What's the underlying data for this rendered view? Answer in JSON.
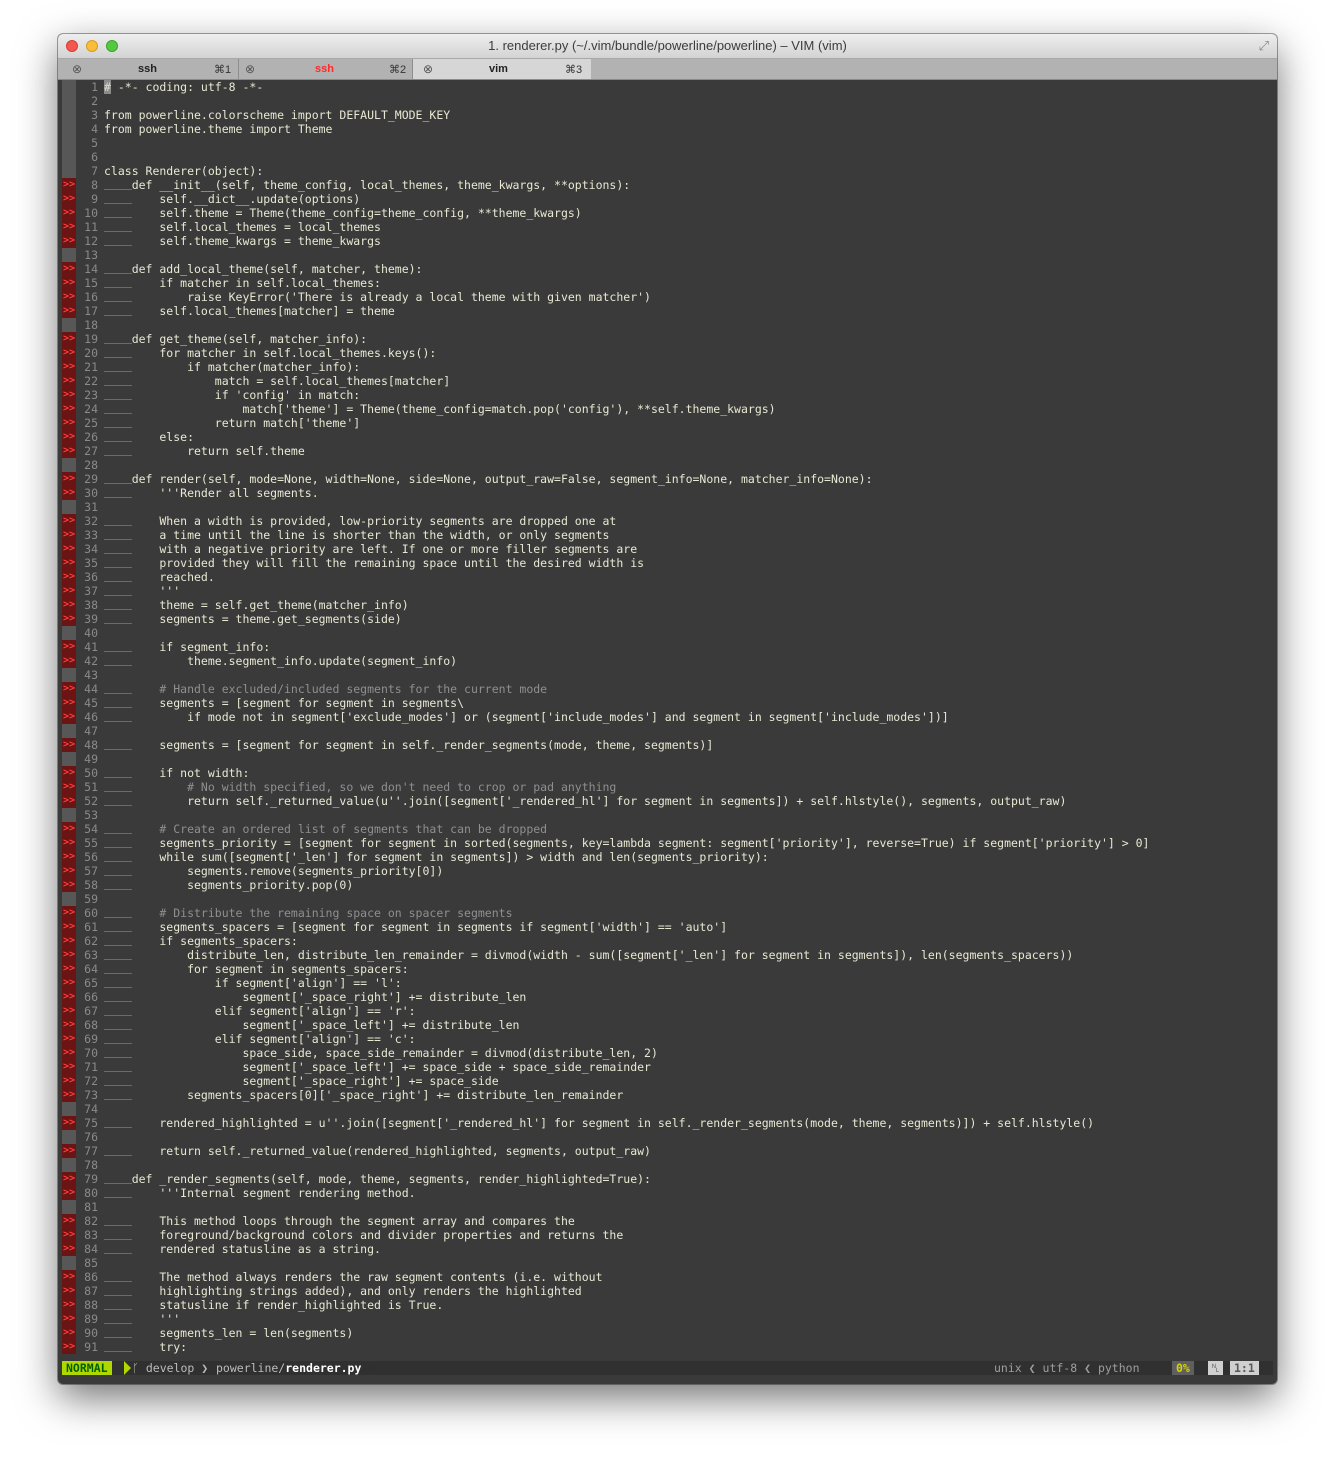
{
  "window": {
    "title": "1. renderer.py (~/.vim/bundle/powerline/powerline) – VIM (vim)"
  },
  "tabs": [
    {
      "close": "⊗",
      "name": "ssh",
      "shortcut": "⌘1",
      "color": "#222222"
    },
    {
      "close": "⊗",
      "name": "ssh",
      "shortcut": "⌘2",
      "color": "#ff2b2b"
    },
    {
      "close": "⊗",
      "name": "vim",
      "shortcut": "⌘3",
      "color": "#222222"
    }
  ],
  "marker": ">>",
  "lines": [
    "# -*- coding: utf-8 -*-",
    "",
    "from powerline.colorscheme import DEFAULT_MODE_KEY",
    "from powerline.theme import Theme",
    "",
    "",
    "class Renderer(object):",
    "    def __init__(self, theme_config, local_themes, theme_kwargs, **options):",
    "        self.__dict__.update(options)",
    "        self.theme = Theme(theme_config=theme_config, **theme_kwargs)",
    "        self.local_themes = local_themes",
    "        self.theme_kwargs = theme_kwargs",
    "",
    "    def add_local_theme(self, matcher, theme):",
    "        if matcher in self.local_themes:",
    "            raise KeyError('There is already a local theme with given matcher')",
    "        self.local_themes[matcher] = theme",
    "",
    "    def get_theme(self, matcher_info):",
    "        for matcher in self.local_themes.keys():",
    "            if matcher(matcher_info):",
    "                match = self.local_themes[matcher]",
    "                if 'config' in match:",
    "                    match['theme'] = Theme(theme_config=match.pop('config'), **self.theme_kwargs)",
    "                return match['theme']",
    "        else:",
    "            return self.theme",
    "",
    "    def render(self, mode=None, width=None, side=None, output_raw=False, segment_info=None, matcher_info=None):",
    "        '''Render all segments.",
    "",
    "        When a width is provided, low-priority segments are dropped one at",
    "        a time until the line is shorter than the width, or only segments",
    "        with a negative priority are left. If one or more filler segments are",
    "        provided they will fill the remaining space until the desired width is",
    "        reached.",
    "        '''",
    "        theme = self.get_theme(matcher_info)",
    "        segments = theme.get_segments(side)",
    "",
    "        if segment_info:",
    "            theme.segment_info.update(segment_info)",
    "",
    "        # Handle excluded/included segments for the current mode",
    "        segments = [segment for segment in segments\\",
    "            if mode not in segment['exclude_modes'] or (segment['include_modes'] and segment in segment['include_modes'])]",
    "",
    "        segments = [segment for segment in self._render_segments(mode, theme, segments)]",
    "",
    "        if not width:",
    "            # No width specified, so we don't need to crop or pad anything",
    "            return self._returned_value(u''.join([segment['_rendered_hl'] for segment in segments]) + self.hlstyle(), segments, output_raw)",
    "",
    "        # Create an ordered list of segments that can be dropped",
    "        segments_priority = [segment for segment in sorted(segments, key=lambda segment: segment['priority'], reverse=True) if segment['priority'] > 0]",
    "        while sum([segment['_len'] for segment in segments]) > width and len(segments_priority):",
    "            segments.remove(segments_priority[0])",
    "            segments_priority.pop(0)",
    "",
    "        # Distribute the remaining space on spacer segments",
    "        segments_spacers = [segment for segment in segments if segment['width'] == 'auto']",
    "        if segments_spacers:",
    "            distribute_len, distribute_len_remainder = divmod(width - sum([segment['_len'] for segment in segments]), len(segments_spacers))",
    "            for segment in segments_spacers:",
    "                if segment['align'] == 'l':",
    "                    segment['_space_right'] += distribute_len",
    "                elif segment['align'] == 'r':",
    "                    segment['_space_left'] += distribute_len",
    "                elif segment['align'] == 'c':",
    "                    space_side, space_side_remainder = divmod(distribute_len, 2)",
    "                    segment['_space_left'] += space_side + space_side_remainder",
    "                    segment['_space_right'] += space_side",
    "            segments_spacers[0]['_space_right'] += distribute_len_remainder",
    "",
    "        rendered_highlighted = u''.join([segment['_rendered_hl'] for segment in self._render_segments(mode, theme, segments)]) + self.hlstyle()",
    "",
    "        return self._returned_value(rendered_highlighted, segments, output_raw)",
    "",
    "    def _render_segments(self, mode, theme, segments, render_highlighted=True):",
    "        '''Internal segment rendering method.",
    "",
    "        This method loops through the segment array and compares the",
    "        foreground/background colors and divider properties and returns the",
    "        rendered statusline as a string.",
    "",
    "        The method always renders the raw segment contents (i.e. without",
    "        highlighting strings added), and only renders the highlighted",
    "        statusline if render_highlighted is True.",
    "        '''",
    "        segments_len = len(segments)",
    "        try:"
  ],
  "statusline": {
    "mode": "NORMAL",
    "branch_icon": "ᚴ",
    "branch": "develop",
    "path_dir": "powerline/",
    "path_file": "renderer.py",
    "fileformat": "unix",
    "encoding": "utf-8",
    "filetype": "python",
    "percent": "0%",
    "line_icon": "␤",
    "position": "1:1"
  },
  "colors": {
    "background": "#3a3a3a",
    "keyword": "#6fb3d2",
    "string": "#e8e8d3",
    "comment": "#8f8f8f",
    "marker": "#ff3b3b",
    "mode_bg": "#afd700"
  }
}
